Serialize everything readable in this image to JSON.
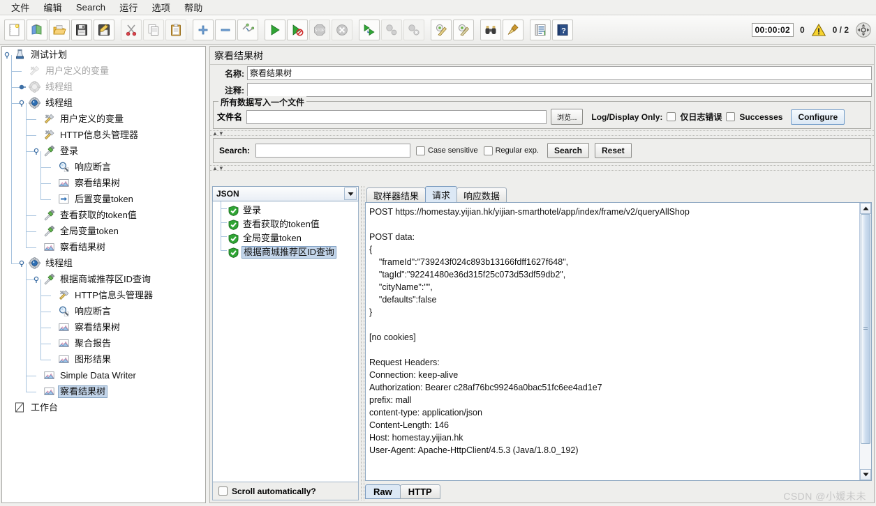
{
  "menubar": {
    "items": [
      {
        "label": "文件",
        "name": "menu-file"
      },
      {
        "label": "编辑",
        "name": "menu-edit"
      },
      {
        "label": "Search",
        "name": "menu-search"
      },
      {
        "label": "运行",
        "name": "menu-run"
      },
      {
        "label": "选项",
        "name": "menu-options"
      },
      {
        "label": "帮助",
        "name": "menu-help"
      }
    ]
  },
  "toolbar": {
    "buttons": [
      {
        "icon": "new-document-icon",
        "tooltip": "New"
      },
      {
        "icon": "templates-icon",
        "tooltip": "Templates"
      },
      {
        "icon": "open-folder-icon",
        "tooltip": "Open"
      },
      {
        "icon": "save-floppy-icon",
        "tooltip": "Save"
      },
      {
        "icon": "save-as-icon",
        "tooltip": "Save As"
      },
      {
        "icon": "cut-scissors-icon",
        "tooltip": "Cut"
      },
      {
        "icon": "copy-icon",
        "tooltip": "Copy"
      },
      {
        "icon": "paste-clipboard-icon",
        "tooltip": "Paste"
      },
      {
        "icon": "expand-plus-icon",
        "tooltip": "Expand All"
      },
      {
        "icon": "collapse-minus-icon",
        "tooltip": "Collapse All"
      },
      {
        "icon": "toggle-icon",
        "tooltip": "Toggle"
      },
      {
        "icon": "start-play-icon",
        "tooltip": "Start"
      },
      {
        "icon": "start-no-pauses-icon",
        "tooltip": "Start no pauses"
      },
      {
        "icon": "stop-icon",
        "tooltip": "Stop"
      },
      {
        "icon": "shutdown-icon",
        "tooltip": "Shutdown"
      },
      {
        "icon": "remote-start-icon",
        "tooltip": "Remote Start All"
      },
      {
        "icon": "remote-stop-icon",
        "tooltip": "Remote Stop All"
      },
      {
        "icon": "remote-shutdown-icon",
        "tooltip": "Remote Shutdown All"
      },
      {
        "icon": "clear-icon",
        "tooltip": "Clear"
      },
      {
        "icon": "clear-all-icon",
        "tooltip": "Clear All"
      },
      {
        "icon": "search-binoculars-icon",
        "tooltip": "Search"
      },
      {
        "icon": "reset-search-broom-icon",
        "tooltip": "Reset Search"
      },
      {
        "icon": "function-helper-icon",
        "tooltip": "Function Helper"
      },
      {
        "icon": "help-book-icon",
        "tooltip": "Help"
      }
    ],
    "status": {
      "timer": "00:00:02",
      "warning_count": "0",
      "warning_icon": "warning-triangle-icon",
      "threads": "0 / 2",
      "connection_icon": "connection-status-icon"
    }
  },
  "tree": {
    "nodes": [
      {
        "label": "测试计划",
        "depth": 0,
        "icon": "test-plan-icon",
        "handle": "expanded",
        "dim": false,
        "selected": false
      },
      {
        "label": "用户定义的变量",
        "depth": 1,
        "icon": "user-variables-icon",
        "handle": "none",
        "dim": true,
        "selected": false
      },
      {
        "label": "线程组",
        "depth": 1,
        "icon": "thread-group-icon",
        "handle": "collapsed",
        "dim": true,
        "selected": false
      },
      {
        "label": "线程组",
        "depth": 1,
        "icon": "thread-group-icon",
        "handle": "expanded",
        "dim": false,
        "selected": false
      },
      {
        "label": "用户定义的变量",
        "depth": 2,
        "icon": "user-variables-icon",
        "handle": "none",
        "dim": false,
        "selected": false
      },
      {
        "label": "HTTP信息头管理器",
        "depth": 2,
        "icon": "header-manager-icon",
        "handle": "none",
        "dim": false,
        "selected": false
      },
      {
        "label": "登录",
        "depth": 2,
        "icon": "http-sampler-icon",
        "handle": "expanded",
        "dim": false,
        "selected": false
      },
      {
        "label": "响应断言",
        "depth": 3,
        "icon": "assertion-icon",
        "handle": "none",
        "dim": false,
        "selected": false
      },
      {
        "label": "察看结果树",
        "depth": 3,
        "icon": "view-results-tree-icon",
        "handle": "none",
        "dim": false,
        "selected": false
      },
      {
        "label": "后置变量token",
        "depth": 3,
        "icon": "post-processor-icon",
        "handle": "none",
        "dim": false,
        "selected": false
      },
      {
        "label": "查看获取的token值",
        "depth": 2,
        "icon": "http-sampler-icon",
        "handle": "none",
        "dim": false,
        "selected": false
      },
      {
        "label": "全局变量token",
        "depth": 2,
        "icon": "http-sampler-icon",
        "handle": "none",
        "dim": false,
        "selected": false
      },
      {
        "label": "察看结果树",
        "depth": 2,
        "icon": "view-results-tree-icon",
        "handle": "none",
        "dim": false,
        "selected": false
      },
      {
        "label": "线程组",
        "depth": 1,
        "icon": "thread-group-icon",
        "handle": "expanded",
        "dim": false,
        "selected": false
      },
      {
        "label": "根据商城推荐区ID查询",
        "depth": 2,
        "icon": "http-sampler-icon",
        "handle": "expanded",
        "dim": false,
        "selected": false
      },
      {
        "label": "HTTP信息头管理器",
        "depth": 3,
        "icon": "header-manager-icon",
        "handle": "none",
        "dim": false,
        "selected": false
      },
      {
        "label": "响应断言",
        "depth": 3,
        "icon": "assertion-icon",
        "handle": "none",
        "dim": false,
        "selected": false
      },
      {
        "label": "察看结果树",
        "depth": 3,
        "icon": "view-results-tree-icon",
        "handle": "none",
        "dim": false,
        "selected": false
      },
      {
        "label": "聚合报告",
        "depth": 3,
        "icon": "view-results-tree-icon",
        "handle": "none",
        "dim": false,
        "selected": false
      },
      {
        "label": "图形结果",
        "depth": 3,
        "icon": "view-results-tree-icon",
        "handle": "none",
        "dim": false,
        "selected": false
      },
      {
        "label": "Simple Data Writer",
        "depth": 2,
        "icon": "view-results-tree-icon",
        "handle": "none",
        "dim": false,
        "selected": false
      },
      {
        "label": "察看结果树",
        "depth": 2,
        "icon": "view-results-tree-icon",
        "handle": "none",
        "dim": false,
        "selected": true
      },
      {
        "label": "工作台",
        "depth": 0,
        "icon": "workbench-icon",
        "handle": "none",
        "dim": false,
        "selected": false
      }
    ]
  },
  "panel": {
    "title": "察看结果树",
    "name_label": "名称:",
    "name_value": "察看结果树",
    "comment_label": "注释:",
    "comment_value": "",
    "filewrite": {
      "group_title": "所有数据写入一个文件",
      "filename_label": "文件名",
      "filename_value": "",
      "browse_button": "浏览...",
      "logdisplay_label": "Log/Display Only:",
      "errors_only_label": "仅日志错误",
      "errors_only_checked": false,
      "successes_label": "Successes",
      "successes_checked": false,
      "configure_button": "Configure"
    },
    "search": {
      "label": "Search:",
      "value": "",
      "case_sensitive_label": "Case sensitive",
      "case_sensitive_checked": false,
      "regular_exp_label": "Regular exp.",
      "regular_exp_checked": false,
      "search_button": "Search",
      "reset_button": "Reset"
    }
  },
  "results": {
    "renderer_selected": "JSON",
    "items": [
      {
        "label": "登录",
        "status": "success",
        "selected": false
      },
      {
        "label": "查看获取的token值",
        "status": "success",
        "selected": false
      },
      {
        "label": "全局变量token",
        "status": "success",
        "selected": false
      },
      {
        "label": "根据商城推荐区ID查询",
        "status": "success",
        "selected": true
      }
    ],
    "scroll_automatically_label": "Scroll automatically?",
    "scroll_automatically_checked": false
  },
  "detail": {
    "tabs": [
      {
        "label": "取样器结果",
        "active": false
      },
      {
        "label": "请求",
        "active": true
      },
      {
        "label": "响应数据",
        "active": false
      }
    ],
    "body": "POST https://homestay.yijian.hk/yijian-smarthotel/app/index/frame/v2/queryAllShop\n\nPOST data:\n{\n    \"frameId\":\"739243f024c893b13166fdff1627f648\",\n    \"tagId\":\"92241480e36d315f25c073d53df59db2\",\n    \"cityName\":\"\",\n    \"defaults\":false\n}\n\n[no cookies]\n\nRequest Headers:\nConnection: keep-alive\nAuthorization: Bearer c28af76bc99246a0bac51fc6ee4ad1e7\nprefix: mall\ncontent-type: application/json\nContent-Length: 146\nHost: homestay.yijian.hk\nUser-Agent: Apache-HttpClient/4.5.3 (Java/1.8.0_192)",
    "bottom_tabs": [
      {
        "label": "Raw",
        "active": true
      },
      {
        "label": "HTTP",
        "active": false
      }
    ]
  },
  "watermark": "CSDN @小媛未未",
  "colors": {
    "accent": "#3a6ea5",
    "selection": "#c3d5ea",
    "success": "#22a12a",
    "warning": "#f2c200",
    "panel_bg": "#eeeeec"
  }
}
